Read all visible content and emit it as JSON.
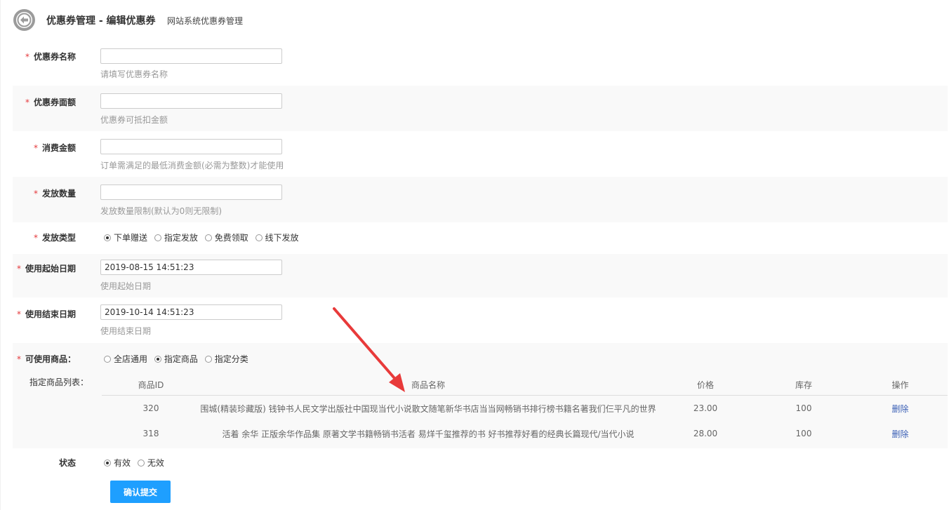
{
  "header": {
    "title": "优惠券管理 - 编辑优惠券",
    "subtitle": "网站系统优惠券管理"
  },
  "form": {
    "name": {
      "label": "优惠券名称",
      "value": "",
      "help": "请填写优惠券名称"
    },
    "amount": {
      "label": "优惠券面额",
      "value": "",
      "help": "优惠券可抵扣金额"
    },
    "min_spend": {
      "label": "消费金额",
      "value": "",
      "help": "订单需满足的最低消费金额(必需为整数)才能使用"
    },
    "quantity": {
      "label": "发放数量",
      "value": "",
      "help": "发放数量限制(默认为0则无限制)"
    },
    "issue_type": {
      "label": "发放类型",
      "options": [
        "下单赠送",
        "指定发放",
        "免费领取",
        "线下发放"
      ],
      "selected": 0
    },
    "start_date": {
      "label": "使用起始日期",
      "value": "2019-08-15 14:51:23",
      "help": "使用起始日期"
    },
    "end_date": {
      "label": "使用结束日期",
      "value": "2019-10-14 14:51:23",
      "help": "使用结束日期"
    },
    "goods_scope": {
      "label": "可使用商品：",
      "options": [
        "全店通用",
        "指定商品",
        "指定分类"
      ],
      "selected": 1
    },
    "goods_list_label": "指定商品列表：",
    "status": {
      "label": "状态",
      "options": [
        "有效",
        "无效"
      ],
      "selected": 0
    },
    "submit_label": "确认提交"
  },
  "goods_table": {
    "headers": [
      "商品ID",
      "商品名称",
      "价格",
      "库存",
      "操作"
    ],
    "rows": [
      {
        "id": "320",
        "name": "围城(精装珍藏版) 钱钟书人民文学出版社中国现当代小说散文随笔新华书店当当网畅销书排行榜书籍名著我们仨平凡的世界",
        "price": "23.00",
        "stock": "100",
        "action": "删除"
      },
      {
        "id": "318",
        "name": "活着 余华 正版余华作品集 原著文学书籍畅销书活者 易烊千玺推荐的书 好书推荐好看的经典长篇现代/当代小说",
        "price": "28.00",
        "stock": "100",
        "action": "删除"
      }
    ]
  },
  "colors": {
    "required_star": "#e4393c",
    "primary_button": "#1e9fff",
    "link": "#3a5fb5",
    "annotation_arrow": "#e83a3a"
  }
}
